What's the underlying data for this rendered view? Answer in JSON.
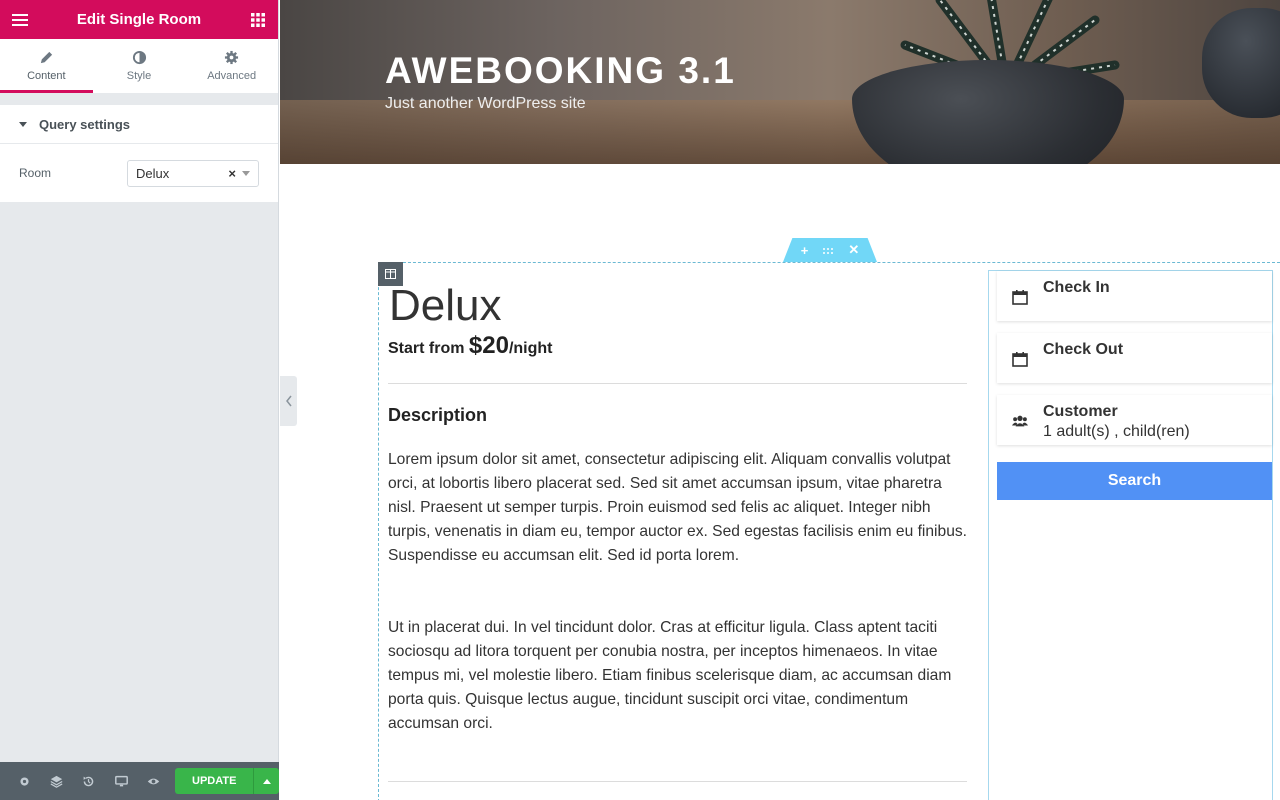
{
  "panel": {
    "title": "Edit Single Room",
    "tabs": [
      {
        "label": "Content",
        "icon": "pencil-icon"
      },
      {
        "label": "Style",
        "icon": "contrast-icon"
      },
      {
        "label": "Advanced",
        "icon": "gear-icon"
      }
    ],
    "section_title": "Query settings",
    "room_label": "Room",
    "room_value": "Delux",
    "update_label": "UPDATE"
  },
  "site": {
    "title": "AWEBOOKING 3.1",
    "tagline": "Just another WordPress site"
  },
  "room": {
    "name": "Delux",
    "price_prefix": "Start from ",
    "price": "$20",
    "price_suffix": "/night",
    "description_heading": "Description",
    "paragraphs": [
      "Lorem ipsum dolor sit amet, consectetur adipiscing elit. Aliquam convallis volutpat orci, at lobortis libero placerat sed. Sed sit amet accumsan ipsum, vitae pharetra nisl. Praesent ut semper turpis. Proin euismod sed felis ac aliquet. Integer nibh turpis, venenatis in diam eu, tempor auctor ex. Sed egestas facilisis enim eu finibus. Suspendisse eu accumsan elit. Sed id porta lorem.",
      "Ut in placerat dui. In vel tincidunt dolor. Cras at efficitur ligula. Class aptent taciti sociosqu ad litora torquent per conubia nostra, per inceptos himenaeos. In vitae tempus mi, vel molestie libero. Etiam finibus scelerisque diam, ac accumsan diam porta quis. Quisque lectus augue, tincidunt suscipit orci vitae, condimentum accumsan orci."
    ]
  },
  "booking": {
    "check_in": "Check In",
    "check_out": "Check Out",
    "customer": "Customer",
    "customer_value": "1 adult(s) , child(ren)",
    "search": "Search"
  },
  "colors": {
    "brand": "#d30c5c",
    "update": "#39b54a",
    "search": "#5191f5",
    "selection": "#71d7f7"
  }
}
